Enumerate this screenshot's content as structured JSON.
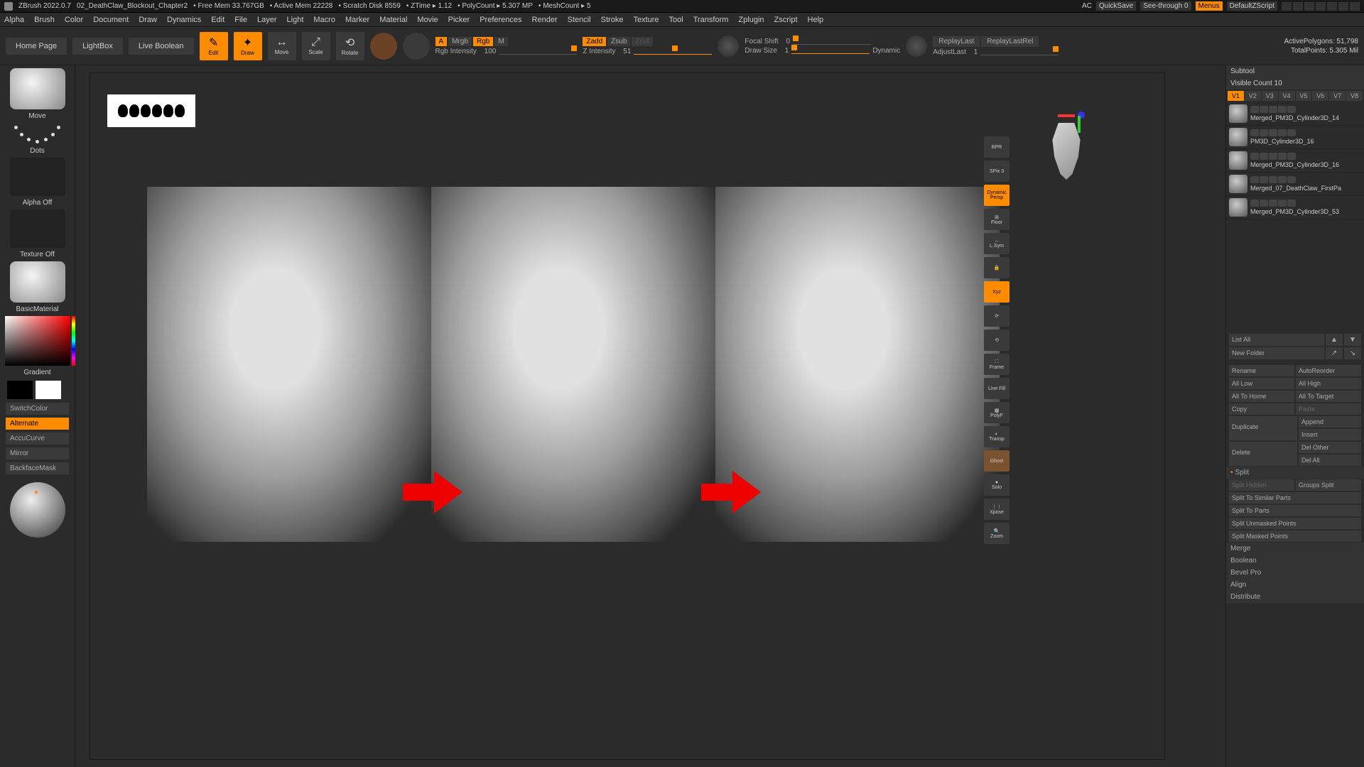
{
  "titlebar": {
    "app": "ZBrush 2022.0.7",
    "file": "02_DeathClaw_Blockout_Chapter2",
    "free_mem": "Free Mem 33.767GB",
    "active_mem": "Active Mem 22228",
    "scratch": "Scratch Disk 8559",
    "ztime": "ZTime ▸ 1.12",
    "polycount": "PolyCount ▸ 5.307 MP",
    "meshcount": "MeshCount ▸ 5",
    "ac": "AC",
    "quicksave": "QuickSave",
    "seethrough": "See-through  0",
    "menus": "Menus",
    "zscript": "DefaultZScript"
  },
  "menu": [
    "Alpha",
    "Brush",
    "Color",
    "Document",
    "Draw",
    "Dynamics",
    "Edit",
    "File",
    "Layer",
    "Light",
    "Macro",
    "Marker",
    "Material",
    "Movie",
    "Picker",
    "Preferences",
    "Render",
    "Stencil",
    "Stroke",
    "Texture",
    "Tool",
    "Transform",
    "Zplugin",
    "Zscript",
    "Help"
  ],
  "toolbar": {
    "home": "Home Page",
    "lightbox": "LightBox",
    "liveboolean": "Live Boolean",
    "edit": "Edit",
    "draw": "Draw",
    "move": "Move",
    "scale": "Scale",
    "rotate": "Rotate",
    "mode_a": "A",
    "mrgb": "Mrgb",
    "rgb": "Rgb",
    "m": "M",
    "rgb_int_label": "Rgb Intensity",
    "rgb_int_val": "100",
    "zadd": "Zadd",
    "zsub": "Zsub",
    "zcut": "Zcut",
    "z_int_label": "Z Intensity",
    "z_int_val": "51",
    "focal_label": "Focal Shift",
    "focal_val": "0",
    "drawsize_label": "Draw Size",
    "drawsize_val": "1",
    "dynamic": "Dynamic",
    "replay": "ReplayLast",
    "replay_rel": "ReplayLastRel",
    "adjust_label": "AdjustLast",
    "adjust_val": "1",
    "active_poly": "ActivePolygons: 51,798",
    "total_pts": "TotalPoints: 5.305 Mil"
  },
  "left": {
    "move": "Move",
    "dots": "Dots",
    "alpha_off": "Alpha Off",
    "texture_off": "Texture Off",
    "material": "BasicMaterial",
    "gradient": "Gradient",
    "switchcolor": "SwitchColor",
    "alternate": "Alternate",
    "accucurve": "AccuCurve",
    "mirror": "Mirror",
    "backface": "BackfaceMask"
  },
  "shelf": {
    "bpr": "BPR",
    "spix": "SPix 3",
    "dynamic": "Dynamic",
    "persp": "Persp",
    "floor": "Floor",
    "lsym": "L.Sym",
    "lock": "🔒",
    "xyz": "Xyz",
    "frame": "Frame",
    "linefill": "Line Fill",
    "polyf": "PolyF",
    "transp": "Transp",
    "ghost": "Ghost",
    "solo": "Solo",
    "xpose": "Xpose",
    "zoom": "Zoom"
  },
  "right": {
    "subtool": "Subtool",
    "visible_count": "Visible Count 10",
    "vtabs": [
      "V1",
      "V2",
      "V3",
      "V4",
      "V5",
      "V6",
      "V7",
      "V8"
    ],
    "subtools": [
      "Merged_PM3D_Cylinder3D_14",
      "PM3D_Cylinder3D_16",
      "Merged_PM3D_Cylinder3D_16",
      "Merged_07_DeathClaw_FirstPa",
      "Merged_PM3D_Cylinder3D_53"
    ],
    "list_all": "List All",
    "new_folder": "New Folder",
    "rename": "Rename",
    "autoreorder": "AutoReorder",
    "all_low": "All Low",
    "all_high": "All High",
    "all_home": "All To Home",
    "all_target": "All To Target",
    "copy": "Copy",
    "paste": "Paste",
    "duplicate": "Duplicate",
    "append": "Append",
    "insert": "Insert",
    "delete": "Delete",
    "del_other": "Del Other",
    "del_all": "Del All",
    "split": "Split",
    "split_hidden": "Split Hidden",
    "groups_split": "Groups Split",
    "split_similar": "Split To Similar Parts",
    "split_parts": "Split To Parts",
    "split_unmasked": "Split Unmasked Points",
    "split_masked": "Split Masked Points",
    "merge": "Merge",
    "boolean": "Boolean",
    "bevelpro": "Bevel Pro",
    "align": "Align",
    "distribute": "Distribute"
  }
}
